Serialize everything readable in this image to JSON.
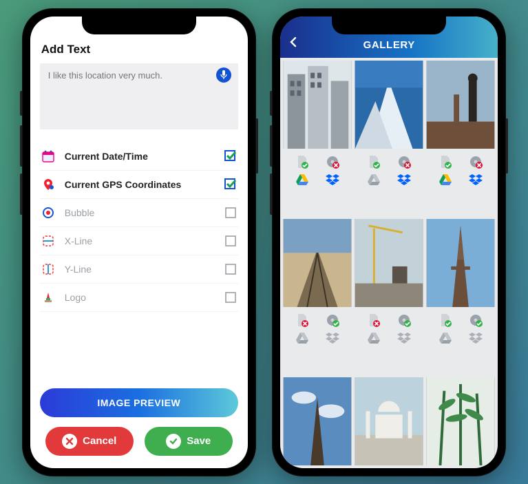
{
  "screen1": {
    "title": "Add Text",
    "textarea": {
      "placeholder": "I like this location very much."
    },
    "options": [
      {
        "icon": "calendar-icon",
        "label": "Current Date/Time",
        "checked": true,
        "bold": true
      },
      {
        "icon": "gps-pin-icon",
        "label": "Current GPS Coordinates",
        "checked": true,
        "bold": true
      },
      {
        "icon": "bubble-icon",
        "label": "Bubble",
        "checked": false,
        "bold": false
      },
      {
        "icon": "xline-icon",
        "label": "X-Line",
        "checked": false,
        "bold": false
      },
      {
        "icon": "yline-icon",
        "label": "Y-Line",
        "checked": false,
        "bold": false
      },
      {
        "icon": "logo-icon",
        "label": "Logo",
        "checked": false,
        "bold": false
      }
    ],
    "preview_button_label": "IMAGE PREVIEW",
    "cancel_label": "Cancel",
    "save_label": "Save"
  },
  "screen2": {
    "title": "GALLERY",
    "thumbs": [
      {
        "kind": "buildings",
        "badge": {
          "doc": "ok",
          "disc": "err",
          "drive": "color",
          "dropbox": "color"
        }
      },
      {
        "kind": "mountain",
        "badge": {
          "doc": "ok",
          "disc": "err",
          "drive": "gray",
          "dropbox": "color"
        }
      },
      {
        "kind": "worker",
        "badge": {
          "doc": "ok",
          "disc": "err",
          "drive": "color",
          "dropbox": "color"
        }
      },
      {
        "kind": "rails",
        "badge": {
          "doc": "err",
          "disc": "ok",
          "drive": "gray",
          "dropbox": "gray"
        }
      },
      {
        "kind": "crane",
        "badge": {
          "doc": "err",
          "disc": "ok",
          "drive": "gray",
          "dropbox": "gray"
        }
      },
      {
        "kind": "eiffel",
        "badge": {
          "doc": "ok",
          "disc": "ok",
          "drive": "gray",
          "dropbox": "gray"
        }
      },
      {
        "kind": "eiffel2",
        "badge": null
      },
      {
        "kind": "taj",
        "badge": null
      },
      {
        "kind": "plant",
        "badge": null
      }
    ]
  }
}
